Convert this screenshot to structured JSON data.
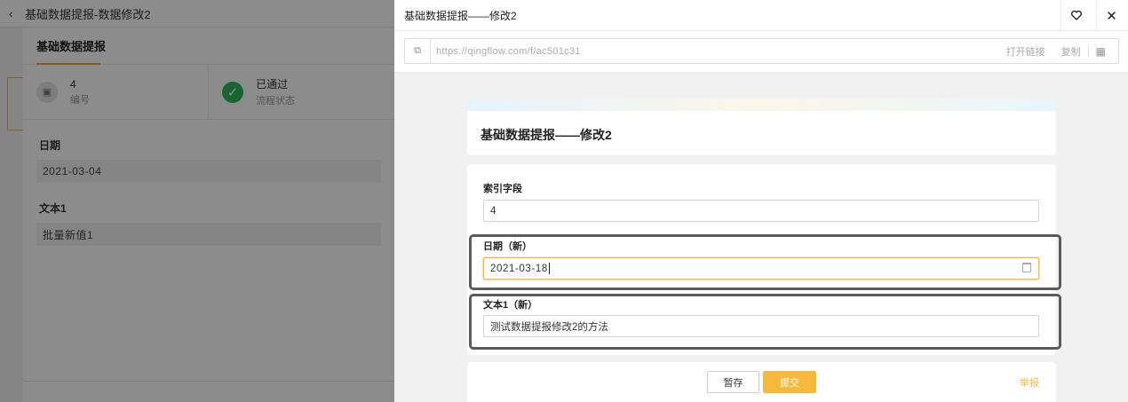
{
  "background_app": {
    "back_icon": "chevron-left-icon",
    "title": "基础数据提报-数据修改2",
    "tab_title": "基础数据提报",
    "stats": [
      {
        "value": "4",
        "label": "编号",
        "icon": "record-icon"
      },
      {
        "value": "已通过",
        "label": "流程状态",
        "icon": "check-circle-icon"
      }
    ],
    "fields": [
      {
        "label": "日期",
        "value": "2021-03-04"
      },
      {
        "label": "文本1",
        "value": "批量新值1"
      }
    ],
    "colors": {
      "accent": "#f6a623",
      "success": "#2eb85c",
      "mask": "rgba(0,0,0,0.45)"
    }
  },
  "drawer": {
    "header_title": "基础数据提报——修改2",
    "favorite_icon": "heart-icon",
    "close_icon": "close-icon",
    "url_bar": {
      "url": "https://qingflow.com/f/ac501c31",
      "open_label": "打开链接",
      "copy_label": "复制",
      "qr_icon": "qrcode-icon",
      "link_icon": "copy-link-icon"
    },
    "form_title": "基础数据提报——修改2",
    "fields": [
      {
        "label": "索引字段",
        "value": "4"
      },
      {
        "label": "日期（新）",
        "value": "2021-03-18",
        "icon": "calendar-icon"
      },
      {
        "label": "文本1（新）",
        "value": "测试数据提报修改2的方法"
      }
    ],
    "actions": {
      "save_label": "暂存",
      "submit_label": "提交",
      "report_label": "举报"
    },
    "colors": {
      "accent": "#f6b93b",
      "highlight_border": "#5b5b5b"
    }
  }
}
